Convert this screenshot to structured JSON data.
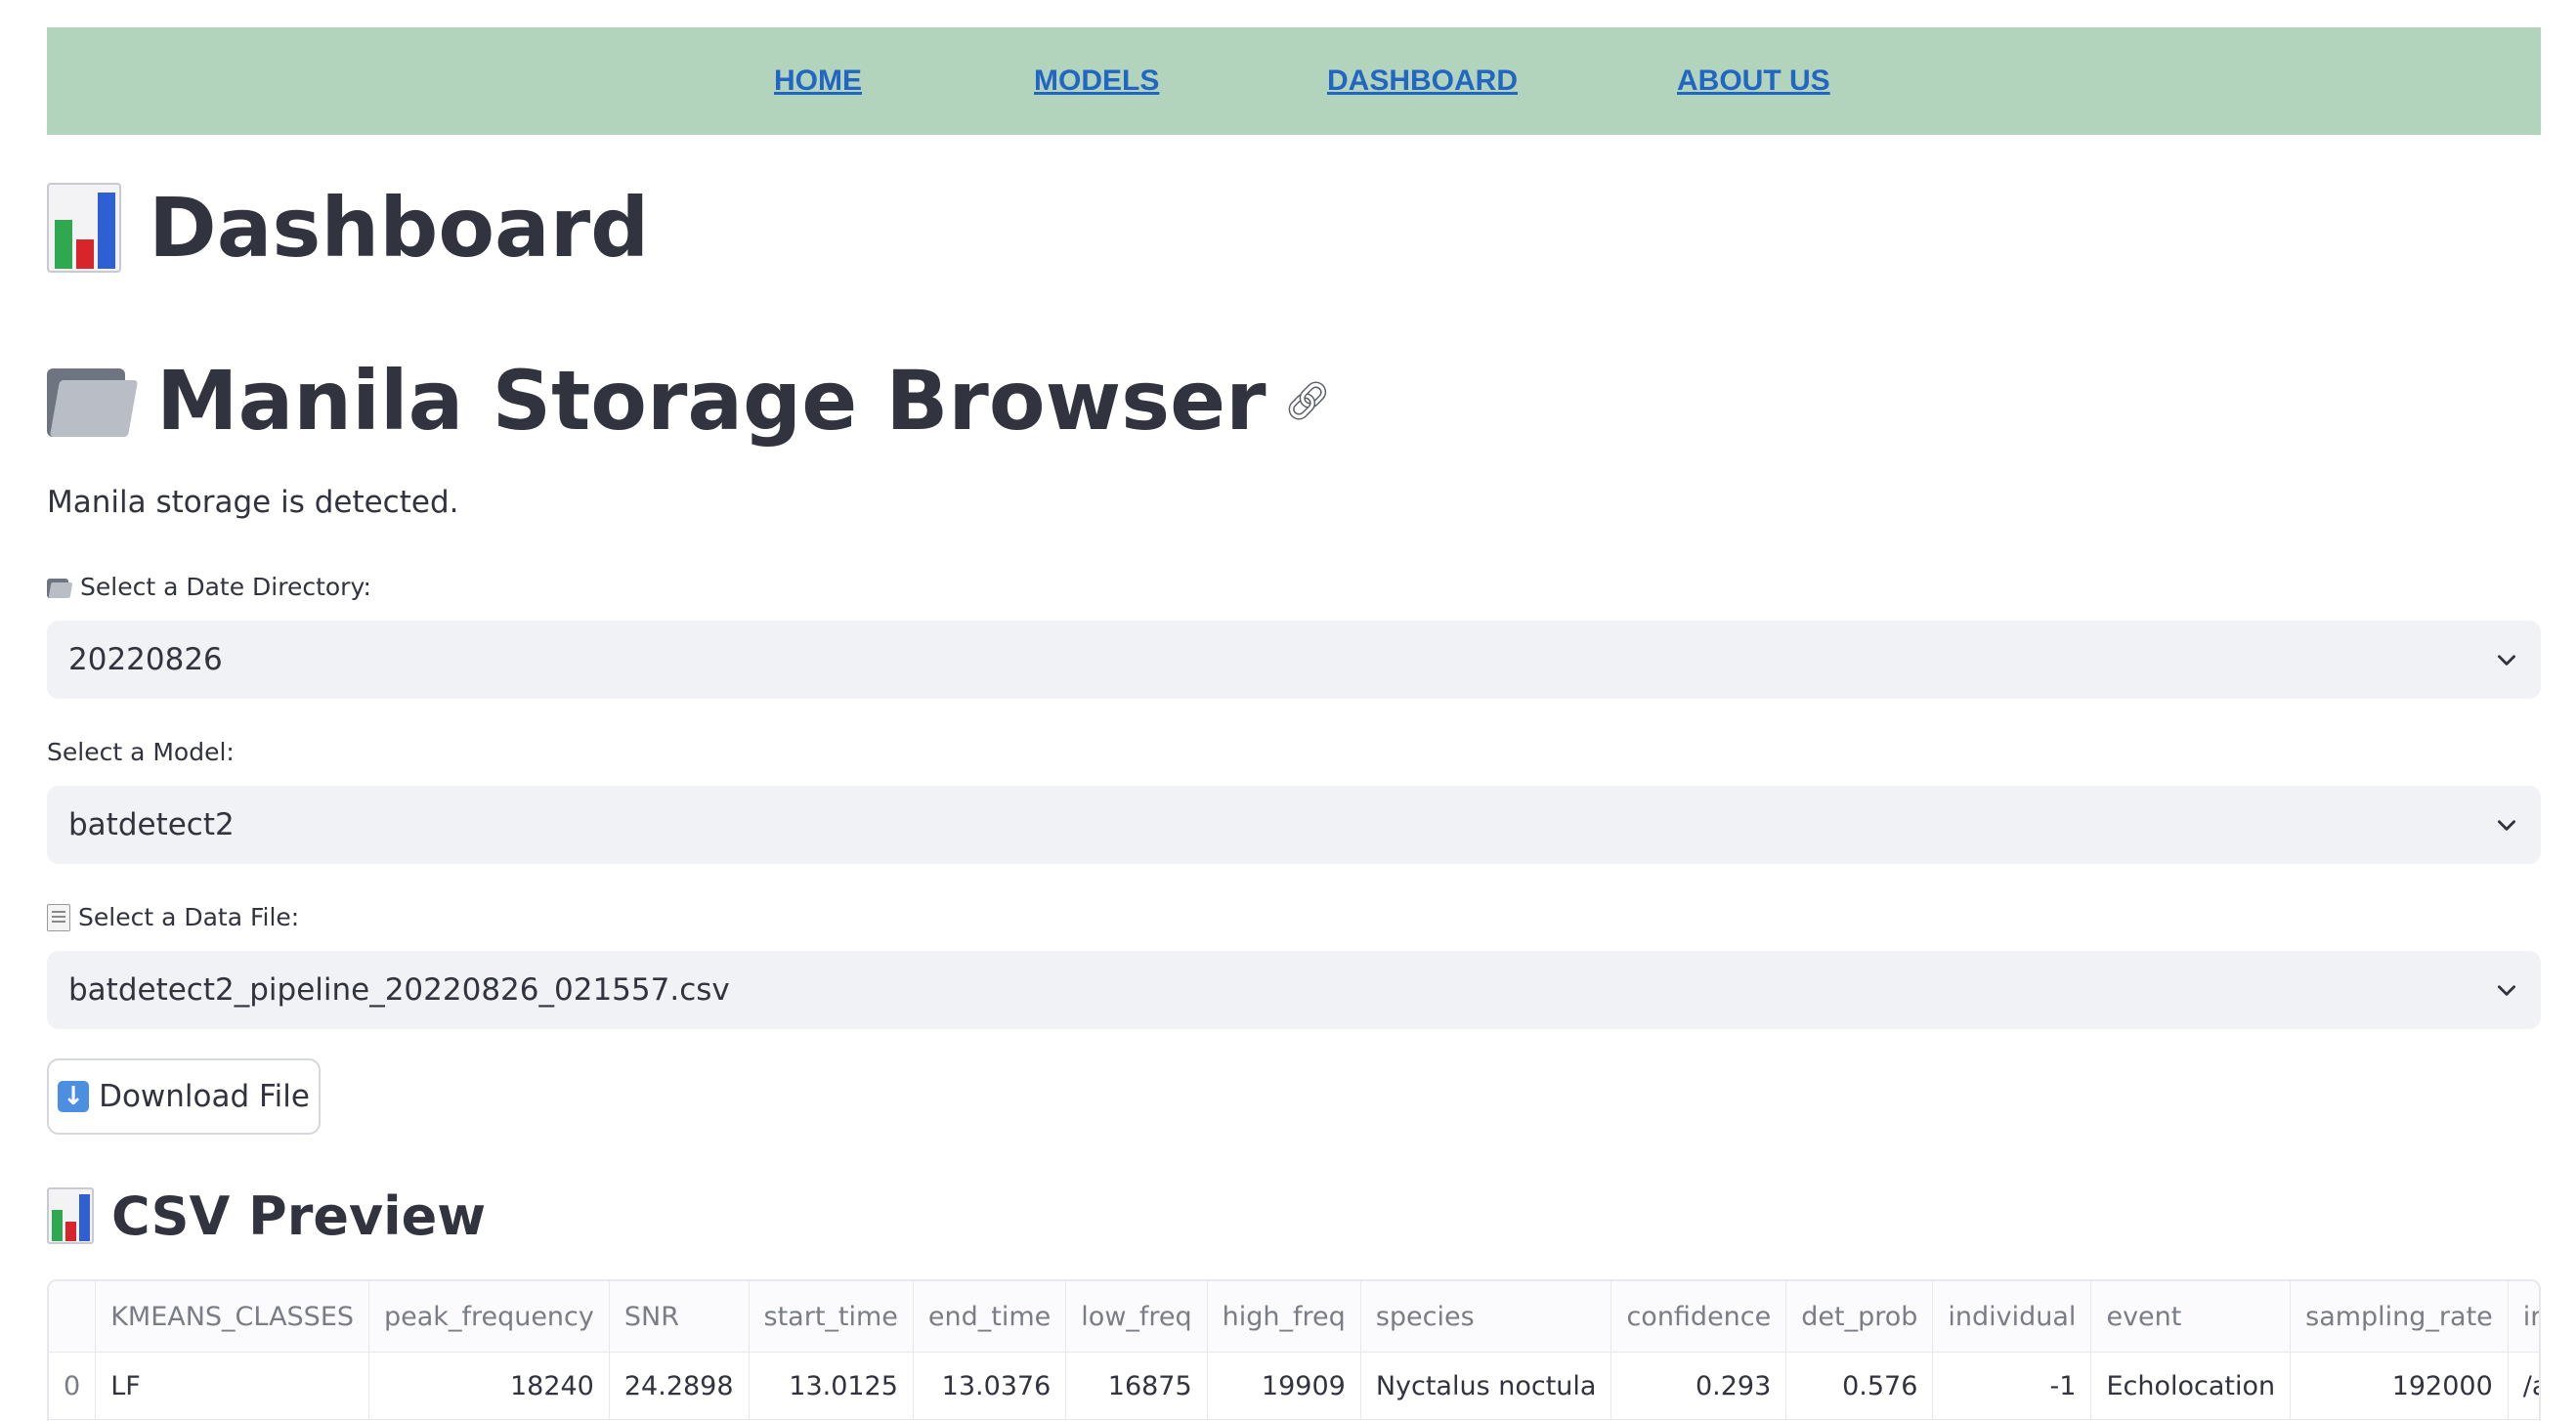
{
  "nav": {
    "links": [
      "HOME",
      "MODELS",
      "DASHBOARD",
      "ABOUT US"
    ]
  },
  "page_title": "Dashboard",
  "section_title": "Manila Storage Browser",
  "status_text": "Manila storage is detected.",
  "date_select": {
    "label": "Select a Date Directory:",
    "value": "20220826"
  },
  "model_select": {
    "label": "Select a Model:",
    "value": "batdetect2"
  },
  "file_select": {
    "label": "Select a Data File:",
    "value": "batdetect2_pipeline_20220826_021557.csv"
  },
  "download_label": "Download File",
  "csv_title": "CSV Preview",
  "table": {
    "columns": [
      "",
      "KMEANS_CLASSES",
      "peak_frequency",
      "SNR",
      "start_time",
      "end_time",
      "low_freq",
      "high_freq",
      "species",
      "confidence",
      "det_prob",
      "individual",
      "event",
      "sampling_rate",
      "input_file"
    ],
    "rows": [
      [
        "0",
        "LF",
        "18240",
        "24.2898",
        "13.0125",
        "13.0376",
        "16875",
        "19909",
        "Nyctalus noctula",
        "0.293",
        "0.576",
        "-1",
        "Echolocation",
        "192000",
        "/app/recordings"
      ]
    ]
  },
  "colors": {
    "navbar_bg": "#b2d4bc",
    "nav_link": "#2266c4",
    "select_bg": "#f0f2f6",
    "text": "#31333F"
  }
}
